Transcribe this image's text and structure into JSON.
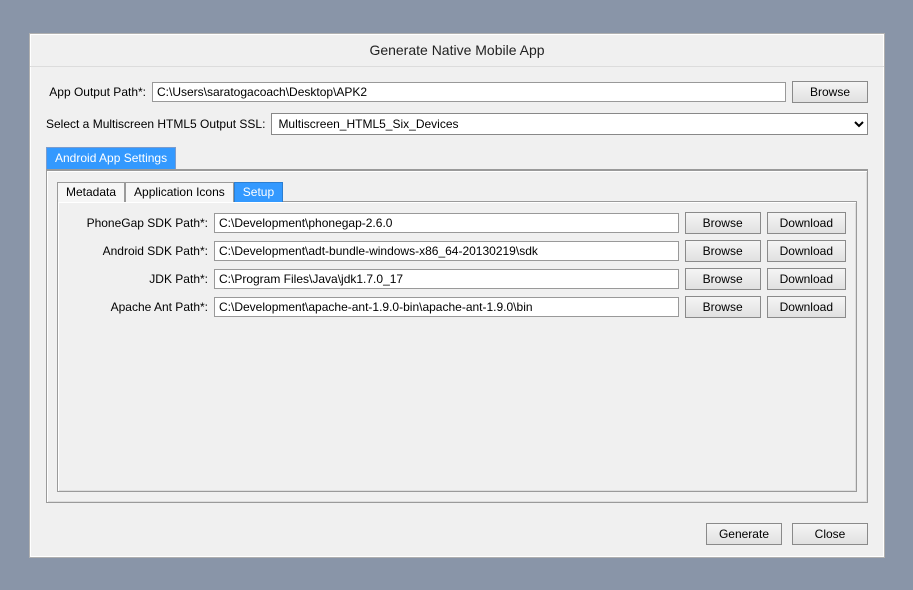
{
  "dialog": {
    "title": "Generate Native Mobile App",
    "output_path_label": "App Output Path*:",
    "output_path_value": "C:\\Users\\saratogacoach\\Desktop\\APK2",
    "browse_label": "Browse",
    "ssl_label": "Select a Multiscreen HTML5 Output SSL:",
    "ssl_value": "Multiscreen_HTML5_Six_Devices",
    "outer_tab_label": "Android App Settings",
    "inner_tabs": {
      "metadata": "Metadata",
      "icons": "Application Icons",
      "setup": "Setup"
    },
    "paths": {
      "phonegap": {
        "label": "PhoneGap SDK Path*:",
        "value": "C:\\Development\\phonegap-2.6.0"
      },
      "android": {
        "label": "Android SDK Path*:",
        "value": "C:\\Development\\adt-bundle-windows-x86_64-20130219\\sdk"
      },
      "jdk": {
        "label": "JDK Path*:",
        "value": "C:\\Program Files\\Java\\jdk1.7.0_17"
      },
      "ant": {
        "label": "Apache Ant Path*:",
        "value": "C:\\Development\\apache-ant-1.9.0-bin\\apache-ant-1.9.0\\bin"
      }
    },
    "download_label": "Download",
    "generate_label": "Generate",
    "close_label": "Close"
  }
}
